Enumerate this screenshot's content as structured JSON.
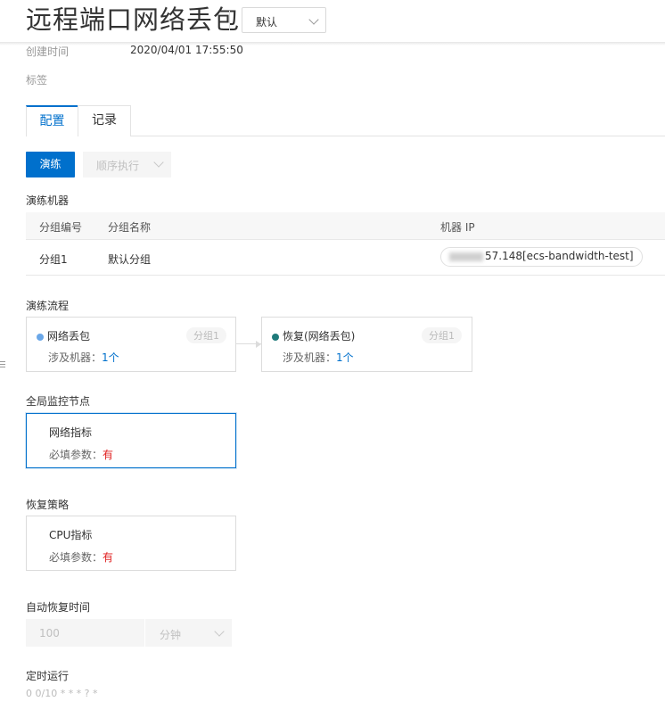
{
  "header": {
    "title": "远程端口网络丢包",
    "env_select": "默认"
  },
  "meta": {
    "created_label": "创建时间",
    "created_value": "2020/04/01 17:55:50",
    "tags_label": "标签"
  },
  "tabs": [
    {
      "label": "配置",
      "active": true
    },
    {
      "label": "记录",
      "active": false
    }
  ],
  "toolbar": {
    "run_label": "演练",
    "order_select": "顺序执行"
  },
  "machines": {
    "section_label": "演练机器",
    "columns": [
      "分组编号",
      "分组名称",
      "机器 IP"
    ],
    "rows": [
      {
        "group_id": "分组1",
        "group_name": "默认分组",
        "ip": "57.148[ecs-bandwidth-test]"
      }
    ]
  },
  "flow": {
    "section_label": "演练流程",
    "steps": [
      {
        "name": "网络丢包",
        "group": "分组1",
        "machines_label": "涉及机器：",
        "machines_count": "1个",
        "dot_color": "#6aa7e8"
      },
      {
        "name": "恢复(网络丢包)",
        "group": "分组1",
        "machines_label": "涉及机器：",
        "machines_count": "1个",
        "dot_color": "#1f7a7a"
      }
    ]
  },
  "monitor": {
    "section_label": "全局监控节点",
    "card_title": "网络指标",
    "param_label": "必填参数：",
    "param_value": "有"
  },
  "recovery": {
    "section_label": "恢复策略",
    "card_title": "CPU指标",
    "param_label": "必填参数：",
    "param_value": "有"
  },
  "auto_recover": {
    "section_label": "自动恢复时间",
    "value": "100",
    "unit": "分钟"
  },
  "schedule": {
    "section_label": "定时运行",
    "cron": "0 0/10 * * * ? *"
  },
  "colors": {
    "accent": "#0070cc",
    "required": "#e02020"
  }
}
